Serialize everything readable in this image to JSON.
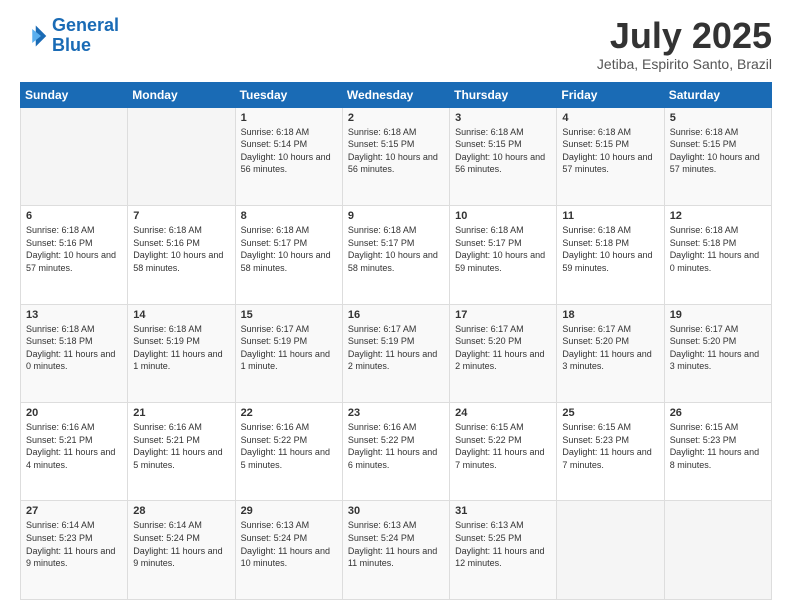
{
  "logo": {
    "line1": "General",
    "line2": "Blue"
  },
  "header": {
    "month": "July 2025",
    "location": "Jetiba, Espirito Santo, Brazil"
  },
  "days_of_week": [
    "Sunday",
    "Monday",
    "Tuesday",
    "Wednesday",
    "Thursday",
    "Friday",
    "Saturday"
  ],
  "weeks": [
    [
      {
        "num": "",
        "info": ""
      },
      {
        "num": "",
        "info": ""
      },
      {
        "num": "1",
        "info": "Sunrise: 6:18 AM\nSunset: 5:14 PM\nDaylight: 10 hours and 56 minutes."
      },
      {
        "num": "2",
        "info": "Sunrise: 6:18 AM\nSunset: 5:15 PM\nDaylight: 10 hours and 56 minutes."
      },
      {
        "num": "3",
        "info": "Sunrise: 6:18 AM\nSunset: 5:15 PM\nDaylight: 10 hours and 56 minutes."
      },
      {
        "num": "4",
        "info": "Sunrise: 6:18 AM\nSunset: 5:15 PM\nDaylight: 10 hours and 57 minutes."
      },
      {
        "num": "5",
        "info": "Sunrise: 6:18 AM\nSunset: 5:15 PM\nDaylight: 10 hours and 57 minutes."
      }
    ],
    [
      {
        "num": "6",
        "info": "Sunrise: 6:18 AM\nSunset: 5:16 PM\nDaylight: 10 hours and 57 minutes."
      },
      {
        "num": "7",
        "info": "Sunrise: 6:18 AM\nSunset: 5:16 PM\nDaylight: 10 hours and 58 minutes."
      },
      {
        "num": "8",
        "info": "Sunrise: 6:18 AM\nSunset: 5:17 PM\nDaylight: 10 hours and 58 minutes."
      },
      {
        "num": "9",
        "info": "Sunrise: 6:18 AM\nSunset: 5:17 PM\nDaylight: 10 hours and 58 minutes."
      },
      {
        "num": "10",
        "info": "Sunrise: 6:18 AM\nSunset: 5:17 PM\nDaylight: 10 hours and 59 minutes."
      },
      {
        "num": "11",
        "info": "Sunrise: 6:18 AM\nSunset: 5:18 PM\nDaylight: 10 hours and 59 minutes."
      },
      {
        "num": "12",
        "info": "Sunrise: 6:18 AM\nSunset: 5:18 PM\nDaylight: 11 hours and 0 minutes."
      }
    ],
    [
      {
        "num": "13",
        "info": "Sunrise: 6:18 AM\nSunset: 5:18 PM\nDaylight: 11 hours and 0 minutes."
      },
      {
        "num": "14",
        "info": "Sunrise: 6:18 AM\nSunset: 5:19 PM\nDaylight: 11 hours and 1 minute."
      },
      {
        "num": "15",
        "info": "Sunrise: 6:17 AM\nSunset: 5:19 PM\nDaylight: 11 hours and 1 minute."
      },
      {
        "num": "16",
        "info": "Sunrise: 6:17 AM\nSunset: 5:19 PM\nDaylight: 11 hours and 2 minutes."
      },
      {
        "num": "17",
        "info": "Sunrise: 6:17 AM\nSunset: 5:20 PM\nDaylight: 11 hours and 2 minutes."
      },
      {
        "num": "18",
        "info": "Sunrise: 6:17 AM\nSunset: 5:20 PM\nDaylight: 11 hours and 3 minutes."
      },
      {
        "num": "19",
        "info": "Sunrise: 6:17 AM\nSunset: 5:20 PM\nDaylight: 11 hours and 3 minutes."
      }
    ],
    [
      {
        "num": "20",
        "info": "Sunrise: 6:16 AM\nSunset: 5:21 PM\nDaylight: 11 hours and 4 minutes."
      },
      {
        "num": "21",
        "info": "Sunrise: 6:16 AM\nSunset: 5:21 PM\nDaylight: 11 hours and 5 minutes."
      },
      {
        "num": "22",
        "info": "Sunrise: 6:16 AM\nSunset: 5:22 PM\nDaylight: 11 hours and 5 minutes."
      },
      {
        "num": "23",
        "info": "Sunrise: 6:16 AM\nSunset: 5:22 PM\nDaylight: 11 hours and 6 minutes."
      },
      {
        "num": "24",
        "info": "Sunrise: 6:15 AM\nSunset: 5:22 PM\nDaylight: 11 hours and 7 minutes."
      },
      {
        "num": "25",
        "info": "Sunrise: 6:15 AM\nSunset: 5:23 PM\nDaylight: 11 hours and 7 minutes."
      },
      {
        "num": "26",
        "info": "Sunrise: 6:15 AM\nSunset: 5:23 PM\nDaylight: 11 hours and 8 minutes."
      }
    ],
    [
      {
        "num": "27",
        "info": "Sunrise: 6:14 AM\nSunset: 5:23 PM\nDaylight: 11 hours and 9 minutes."
      },
      {
        "num": "28",
        "info": "Sunrise: 6:14 AM\nSunset: 5:24 PM\nDaylight: 11 hours and 9 minutes."
      },
      {
        "num": "29",
        "info": "Sunrise: 6:13 AM\nSunset: 5:24 PM\nDaylight: 11 hours and 10 minutes."
      },
      {
        "num": "30",
        "info": "Sunrise: 6:13 AM\nSunset: 5:24 PM\nDaylight: 11 hours and 11 minutes."
      },
      {
        "num": "31",
        "info": "Sunrise: 6:13 AM\nSunset: 5:25 PM\nDaylight: 11 hours and 12 minutes."
      },
      {
        "num": "",
        "info": ""
      },
      {
        "num": "",
        "info": ""
      }
    ]
  ]
}
